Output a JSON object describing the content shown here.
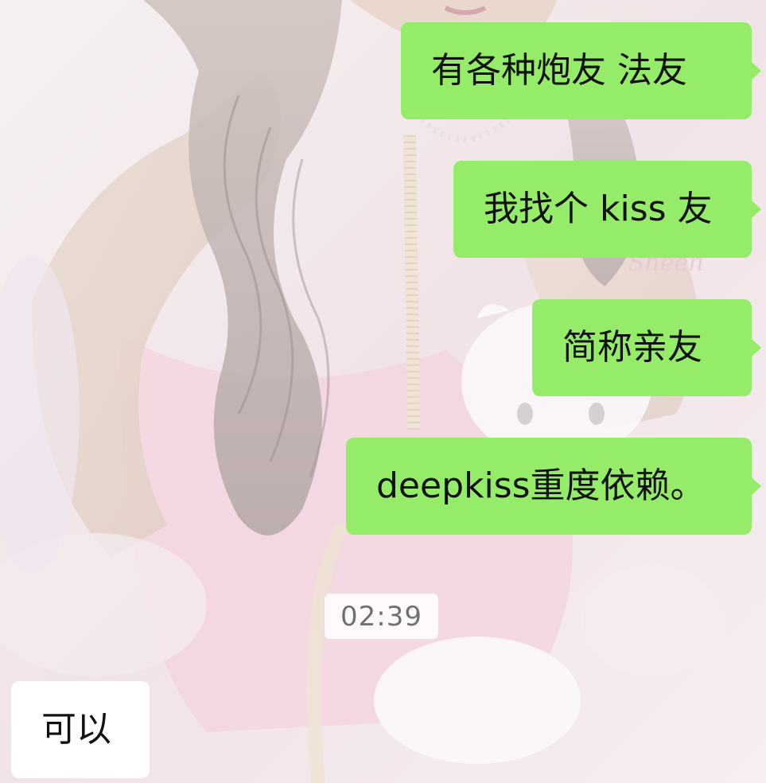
{
  "chat": {
    "messages": [
      {
        "side": "out",
        "text": "有各种炮友 法友"
      },
      {
        "side": "out",
        "text": "我找个 kiss 友"
      },
      {
        "side": "out",
        "text": "简称亲友"
      },
      {
        "side": "out",
        "text": "deepkiss重度依赖。"
      },
      {
        "side": "in",
        "text": "可以"
      }
    ],
    "timestamp": "02:39"
  },
  "colors": {
    "outgoing_bubble": "#95ec69",
    "incoming_bubble": "#ffffff",
    "timestamp_text": "#707070"
  }
}
